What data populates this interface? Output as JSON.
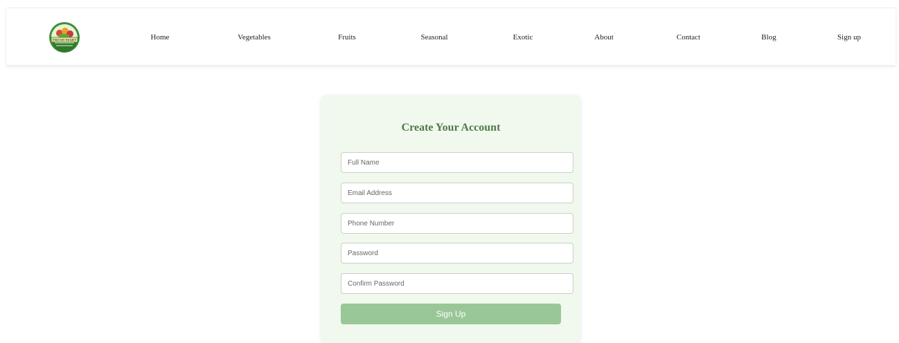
{
  "header": {
    "logo_text": "FRESH MART",
    "nav": [
      {
        "label": "Home"
      },
      {
        "label": "Vegetables"
      },
      {
        "label": "Fruits"
      },
      {
        "label": "Seasonal"
      },
      {
        "label": "Exotic"
      },
      {
        "label": "About"
      },
      {
        "label": "Contact"
      },
      {
        "label": "Blog"
      },
      {
        "label": "Sign up"
      }
    ]
  },
  "form": {
    "title": "Create Your Account",
    "fields": [
      {
        "placeholder": "Full Name",
        "value": ""
      },
      {
        "placeholder": "Email Address",
        "value": ""
      },
      {
        "placeholder": "Phone Number",
        "value": ""
      },
      {
        "placeholder": "Password",
        "value": ""
      },
      {
        "placeholder": "Confirm Password",
        "value": ""
      }
    ],
    "submit_label": "Sign Up"
  },
  "colors": {
    "accent_green": "#4e7a48",
    "button_green": "#99c797",
    "card_background": "#f1f8ee"
  }
}
